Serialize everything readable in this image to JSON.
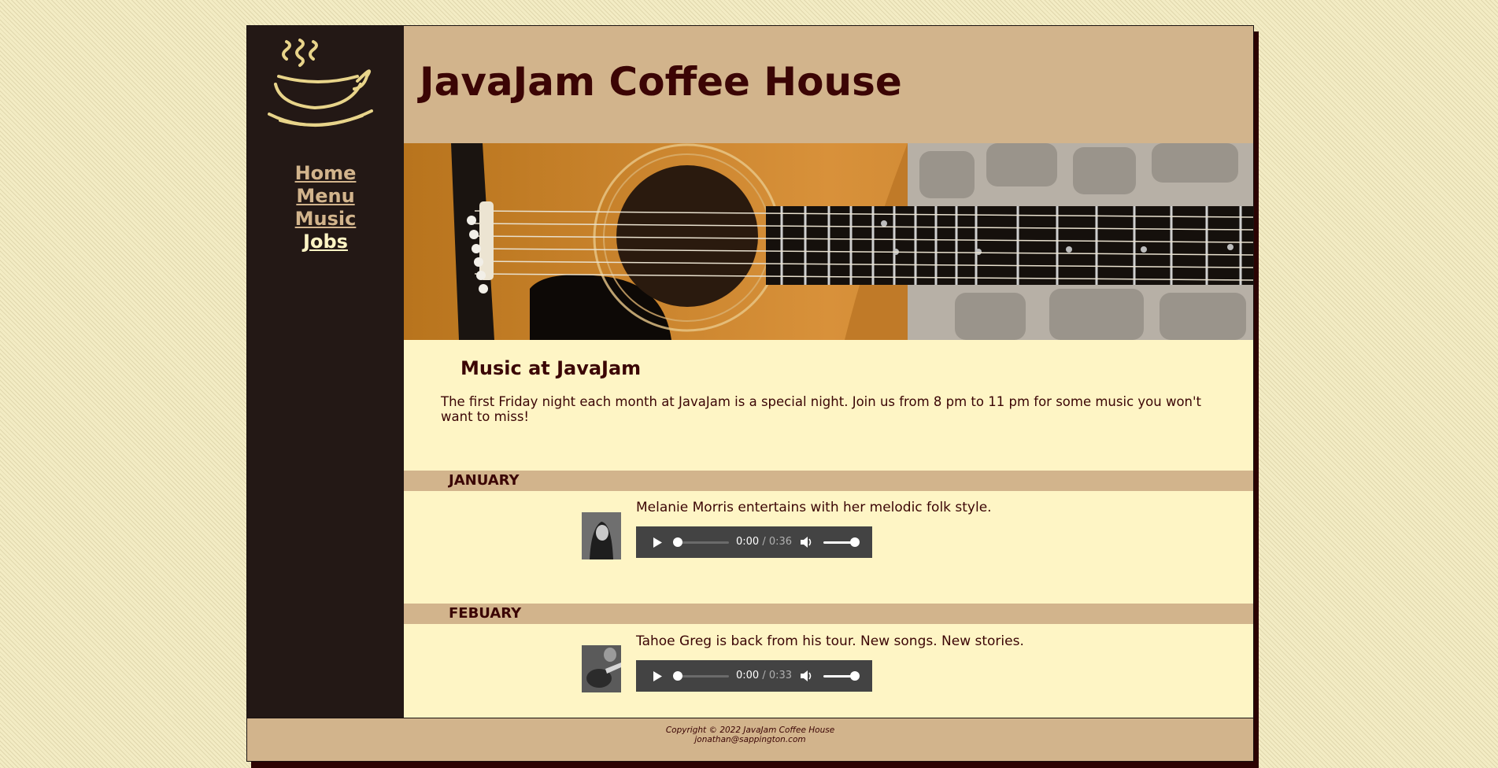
{
  "header": {
    "title": "JavaJam Coffee House"
  },
  "nav": {
    "items": [
      {
        "label": "Home"
      },
      {
        "label": "Menu"
      },
      {
        "label": "Music"
      },
      {
        "label": "Jobs"
      }
    ],
    "current": "Jobs"
  },
  "main": {
    "heading": "Music at JavaJam",
    "intro": "The first Friday night each month at JavaJam is a special night. Join us from 8 pm to 11 pm for some music you won't want to miss!",
    "events": [
      {
        "month": "JANUARY",
        "description": "Melanie Morris entertains with her melodic folk style.",
        "player": {
          "current_time": "0:00",
          "duration": "/ 0:36",
          "progress": 0,
          "volume": 1
        }
      },
      {
        "month": "FEBUARY",
        "description": "Tahoe Greg is back from his tour. New songs. New stories.",
        "player": {
          "current_time": "0:00",
          "duration": "/ 0:33",
          "progress": 0,
          "volume": 1
        }
      }
    ]
  },
  "footer": {
    "copyright": "Copyright © 2022 JavaJam Coffee House",
    "email": "jonathan@sappington.com"
  },
  "colors": {
    "dark_brown": "#231815",
    "tan": "#d2b48c",
    "cream": "#fef5c5",
    "maroon_text": "#3b0505"
  },
  "icons": [
    "coffee-cup-logo-icon",
    "play-icon",
    "volume-icon"
  ]
}
